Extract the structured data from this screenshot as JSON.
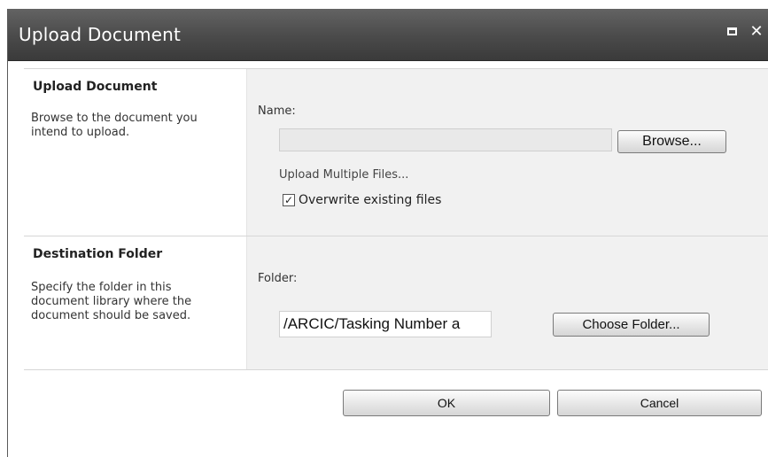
{
  "dialog": {
    "title": "Upload Document"
  },
  "upload_section": {
    "heading": "Upload Document",
    "description": "Browse to the document you intend to upload.",
    "name_label": "Name:",
    "name_value": "",
    "browse_label": "Browse...",
    "multi_files_label": "Upload Multiple Files...",
    "overwrite_label": "Overwrite existing files",
    "overwrite_checked": true
  },
  "destination_section": {
    "heading": "Destination Folder",
    "description": "Specify the folder in this document library where the document should be saved.",
    "folder_label": "Folder:",
    "folder_value": "/ARCIC/Tasking Number a",
    "choose_label": "Choose Folder..."
  },
  "footer": {
    "ok_label": "OK",
    "cancel_label": "Cancel"
  },
  "icons": {
    "maximize": "maximize-icon",
    "close": "close-icon",
    "check": "check-icon"
  },
  "colors": {
    "titlebar": "#4a4a4a",
    "panel": "#f1f1f1"
  }
}
